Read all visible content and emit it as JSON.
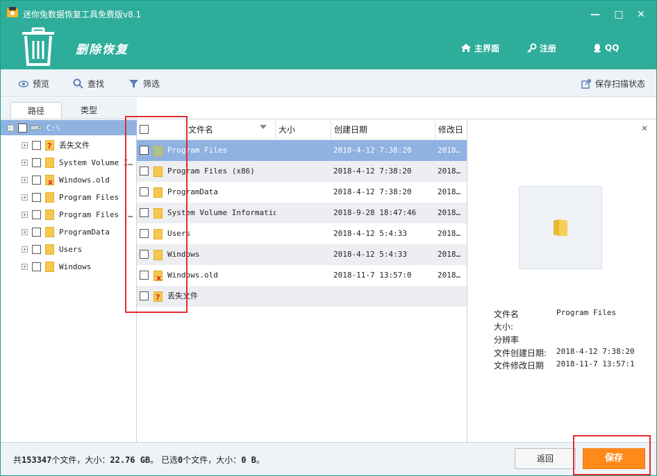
{
  "window": {
    "title": "迷你兔数据恢复工具免费版v8.1",
    "mode_title": "删除恢复",
    "controls": {
      "minimize": "—",
      "maximize": "□",
      "close": "✕"
    }
  },
  "topnav": [
    {
      "label": "主界面",
      "icon": "home-icon"
    },
    {
      "label": "注册",
      "icon": "key-icon"
    },
    {
      "label": "QQ",
      "icon": "qq-icon"
    }
  ],
  "toolbar": {
    "preview": "预览",
    "find": "查找",
    "filter": "筛选",
    "save_scan": "保存扫描状态"
  },
  "tabs": {
    "path": "路径",
    "type": "类型"
  },
  "tree": {
    "root": "C:\\",
    "items": [
      {
        "label": "丢失文件",
        "mark": "?"
      },
      {
        "label": "System Volume I…",
        "mark": ""
      },
      {
        "label": "Windows.old",
        "mark": "x"
      },
      {
        "label": "Program Files",
        "mark": ""
      },
      {
        "label": "Program Files (…",
        "mark": ""
      },
      {
        "label": "ProgramData",
        "mark": ""
      },
      {
        "label": "Users",
        "mark": ""
      },
      {
        "label": "Windows",
        "mark": ""
      }
    ]
  },
  "grid": {
    "columns": {
      "name": "文件名",
      "size": "大小",
      "created": "创建日期",
      "modified": "修改日"
    },
    "rows": [
      {
        "name": "Program Files",
        "created": "2018-4-12 7:38:20",
        "modified": "2018…",
        "mark": ""
      },
      {
        "name": "Program Files (x86)",
        "created": "2018-4-12 7:38:20",
        "modified": "2018…",
        "mark": ""
      },
      {
        "name": "ProgramData",
        "created": "2018-4-12 7:38:20",
        "modified": "2018…",
        "mark": ""
      },
      {
        "name": "System Volume Information",
        "created": "2018-9-28 18:47:46",
        "modified": "2018…",
        "mark": ""
      },
      {
        "name": "Users",
        "created": "2018-4-12 5:4:33",
        "modified": "2018…",
        "mark": ""
      },
      {
        "name": "Windows",
        "created": "2018-4-12 5:4:33",
        "modified": "2018…",
        "mark": ""
      },
      {
        "name": "Windows.old",
        "created": "2018-11-7 13:57:0",
        "modified": "2018…",
        "mark": "x"
      },
      {
        "name": "丢失文件",
        "created": "",
        "modified": "",
        "mark": "?"
      }
    ]
  },
  "preview": {
    "close": "✕",
    "labels": {
      "name": "文件名",
      "size": "大小:",
      "resolution": "分辨率",
      "created": "文件创建日期:",
      "modified": "文件修改日期"
    },
    "values": {
      "name": "Program Files",
      "size": "",
      "resolution": "",
      "created": "2018-4-12 7:38:20",
      "modified": "2018-11-7 13:57:1"
    }
  },
  "status": {
    "prefix": "共",
    "total_files": "153347",
    "mid1": "个文件，大小：",
    "total_size": "22.76 GB",
    "mid2": "。 已选",
    "selected_files": "0",
    "mid3": "个文件，大小：",
    "selected_size": "0 B",
    "suffix": "。"
  },
  "buttons": {
    "back": "返回",
    "save": "保存"
  },
  "colors": {
    "header": "#2fad9b",
    "selection": "#8fb2e0",
    "save": "#ff8a1a",
    "highlight": "#e02c2c"
  }
}
